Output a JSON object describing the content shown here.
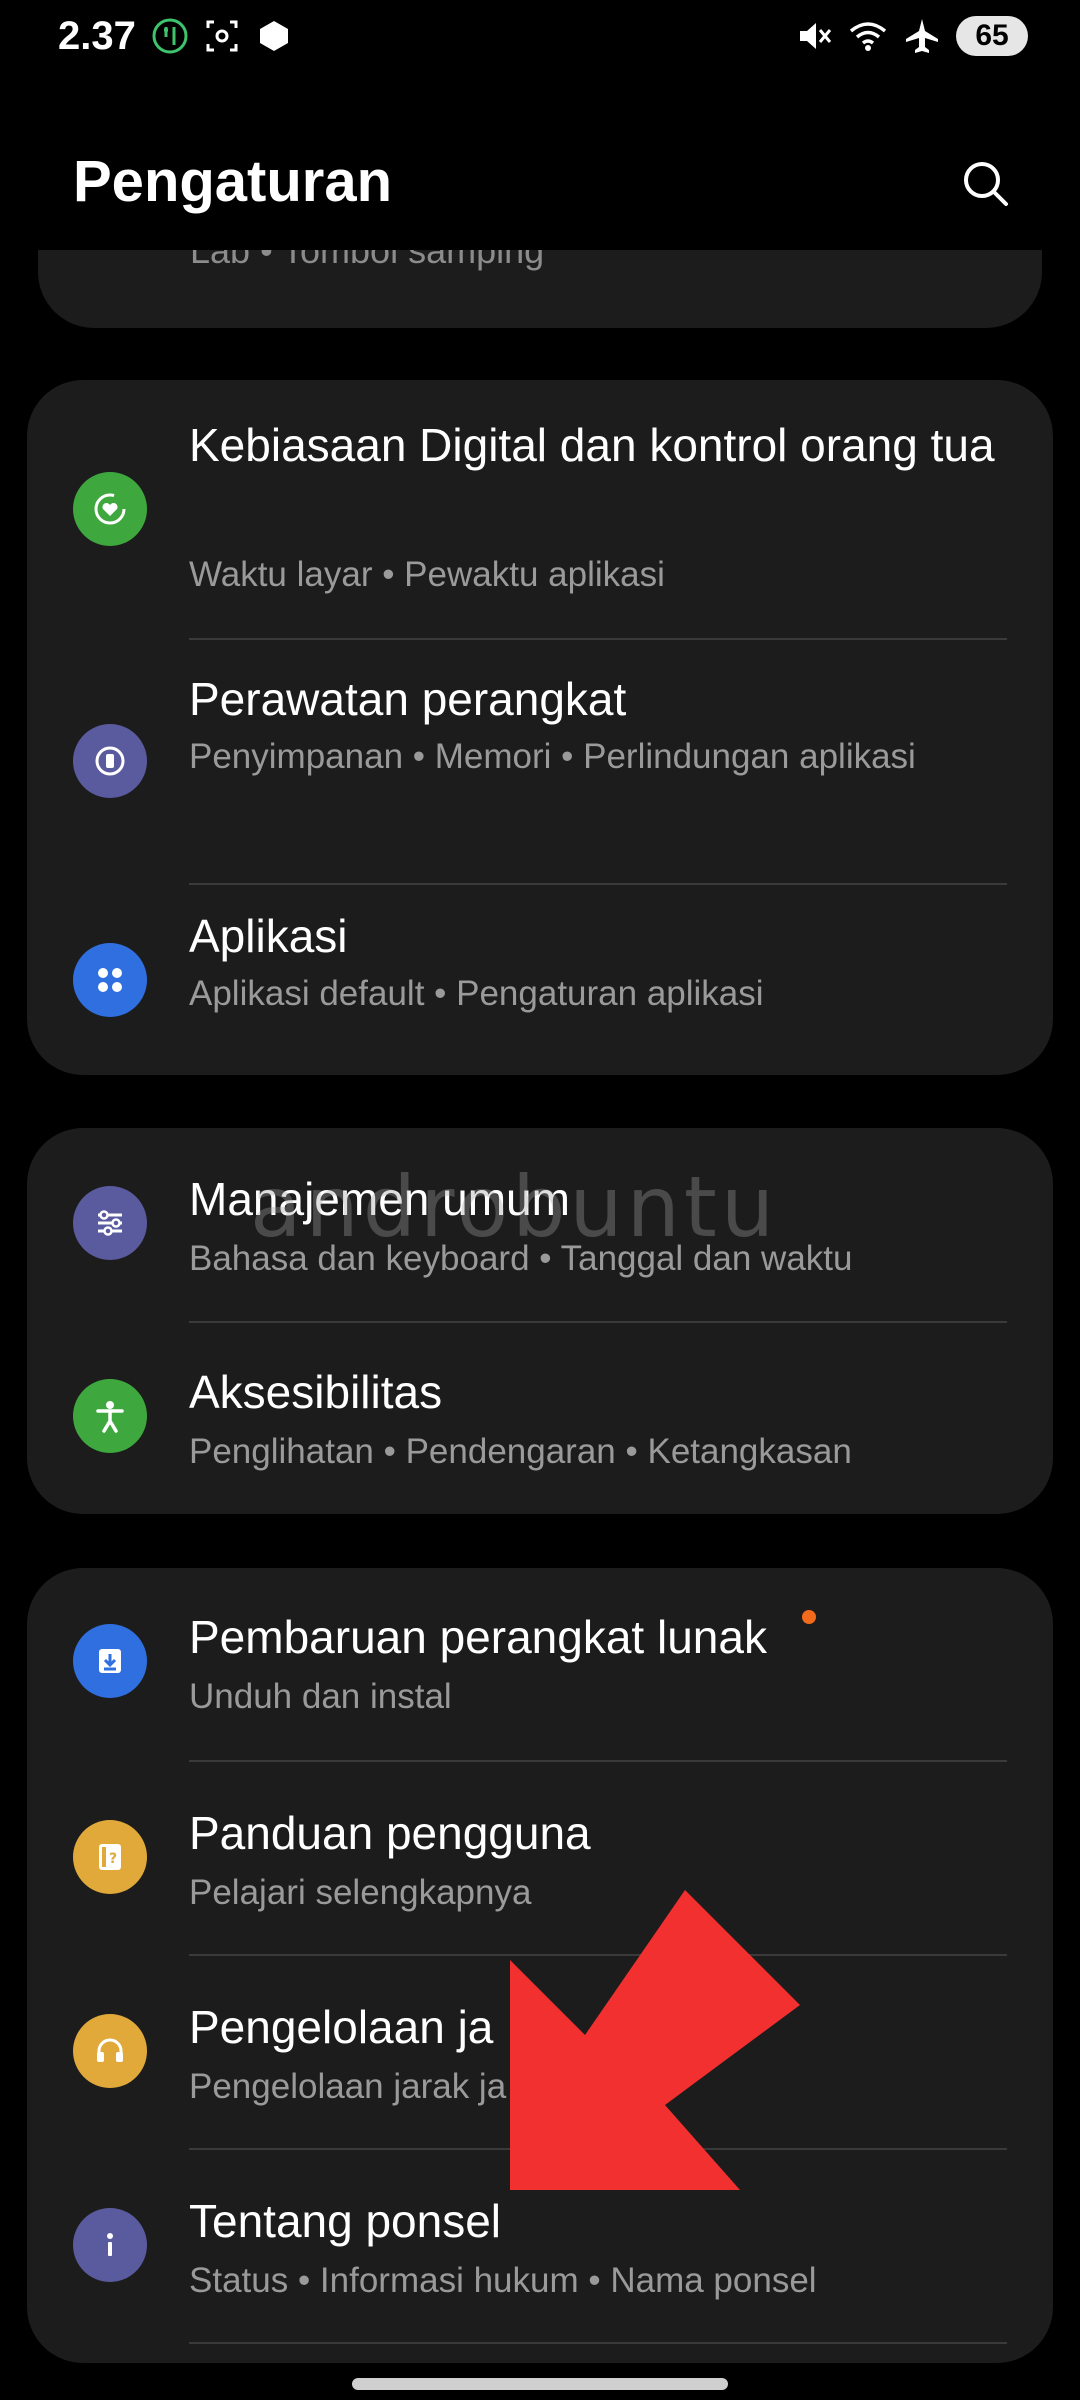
{
  "status_bar": {
    "time": "2.37",
    "battery": "65",
    "left_icons": [
      "timer-icon",
      "screenshot-icon",
      "shield-app-icon"
    ],
    "right_icons": [
      "mute-icon",
      "wifi-icon",
      "airplane-icon"
    ]
  },
  "header": {
    "title": "Pengaturan",
    "search_icon": "search-icon"
  },
  "partial_item": {
    "subtitle": "Lab  •  Tombol samping"
  },
  "cards": [
    {
      "items": [
        {
          "title": "Kebiasaan Digital dan kontrol orang tua",
          "subtitle": "Waktu layar  •  Pewaktu aplikasi",
          "icon": "digital-wellbeing-icon",
          "color": "#3ea73e"
        },
        {
          "title": "Perawatan perangkat",
          "subtitle": "Penyimpanan  •  Memori  •  Perlindungan aplikasi",
          "icon": "device-care-icon",
          "color": "#5a5a9e"
        },
        {
          "title": "Aplikasi",
          "subtitle": "Aplikasi default  •  Pengaturan aplikasi",
          "icon": "apps-icon",
          "color": "#2f6fe0"
        }
      ]
    },
    {
      "items": [
        {
          "title": "Manajemen umum",
          "subtitle": "Bahasa dan keyboard  •  Tanggal dan waktu",
          "icon": "sliders-icon",
          "color": "#5a5a9e"
        },
        {
          "title": "Aksesibilitas",
          "subtitle": "Penglihatan  •  Pendengaran  •  Ketangkasan",
          "icon": "accessibility-icon",
          "color": "#3ea73e"
        }
      ]
    },
    {
      "items": [
        {
          "title": "Pembaruan perangkat lunak",
          "subtitle": "Unduh dan instal",
          "icon": "download-icon",
          "color": "#2f6fe0"
        },
        {
          "title": "Panduan pengguna",
          "subtitle": "Pelajari selengkapnya",
          "icon": "user-guide-icon",
          "color": "#e0a93a"
        },
        {
          "title": "Pengelolaan ja",
          "subtitle": "Pengelolaan jarak ja",
          "icon": "headset-icon",
          "color": "#e0a93a"
        },
        {
          "title": "Tentang ponsel",
          "subtitle": "Status  •  Informasi hukum  •  Nama ponsel",
          "icon": "info-icon",
          "color": "#5a5a9e"
        }
      ]
    }
  ],
  "watermark": "androbuntu",
  "colors": {
    "background": "#000000",
    "card": "#1c1c1c",
    "subtitle": "#9a9a9a",
    "notification_dot": "#f26a1b",
    "arrow": "#f2302f"
  }
}
